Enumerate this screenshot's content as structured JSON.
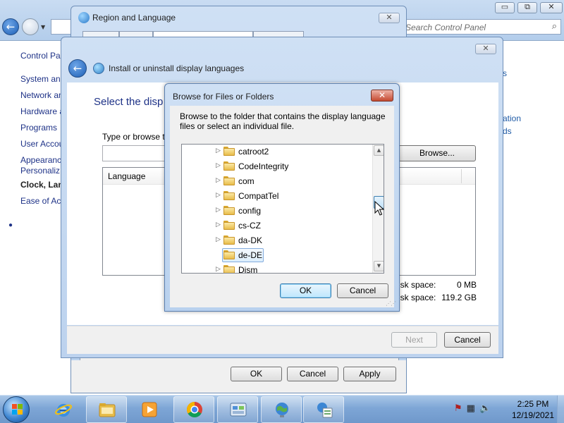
{
  "control_panel": {
    "search_placeholder": "Search Control Panel",
    "window_buttons": [
      "▭",
      "⧉",
      "✕"
    ],
    "sidebar": [
      {
        "label": "Control Pa",
        "active": false
      },
      {
        "label": "System and",
        "active": false
      },
      {
        "label": "Network an",
        "active": false
      },
      {
        "label": "Hardware a",
        "active": false
      },
      {
        "label": "Programs",
        "active": false
      },
      {
        "label": "User Accou",
        "active": false
      },
      {
        "label": "Appearanc",
        "active": false
      },
      {
        "label": "Personaliz",
        "active": false
      },
      {
        "label": "Clock, Lang",
        "active": true
      },
      {
        "label": "Ease of Acc",
        "active": false
      }
    ],
    "right_links": [
      "s",
      "ation",
      "ds"
    ]
  },
  "region_language": {
    "title": "Region and Language",
    "close_glyph": "✕",
    "ok_label": "OK",
    "cancel_label": "Cancel",
    "apply_label": "Apply"
  },
  "install_dialog": {
    "title": "Install or uninstall display languages",
    "heading": "Select the disp",
    "type_label": "Type or browse t",
    "browse_label": "Browse...",
    "column_language": "Language",
    "disk_required_label": "isk space:",
    "disk_required_value": "0 MB",
    "disk_available_label": "isk space:",
    "disk_available_value": "119.2 GB",
    "next_label": "Next",
    "cancel_label": "Cancel",
    "close_glyph": "✕",
    "back_glyph": "←"
  },
  "browse_dialog": {
    "title": "Browse for Files or Folders",
    "close_glyph": "✕",
    "instructions": "Browse to the folder that contains the display language files or select an individual file.",
    "tree": [
      {
        "label": "catroot2",
        "selected": false
      },
      {
        "label": "CodeIntegrity",
        "selected": false
      },
      {
        "label": "com",
        "selected": false
      },
      {
        "label": "CompatTel",
        "selected": false
      },
      {
        "label": "config",
        "selected": false
      },
      {
        "label": "cs-CZ",
        "selected": false
      },
      {
        "label": "da-DK",
        "selected": false
      },
      {
        "label": "de-DE",
        "selected": true
      },
      {
        "label": "Dism",
        "selected": false
      }
    ],
    "ok_label": "OK",
    "cancel_label": "Cancel"
  },
  "taskbar": {
    "time": "2:25 PM",
    "date": "12/19/2021",
    "apps": [
      "internet-explorer",
      "windows-explorer",
      "media-player",
      "chrome",
      "control-panel",
      "region-globe",
      "language-tool"
    ]
  },
  "colors": {
    "link_blue": "#1e3287",
    "title_bar": "#b9d1ee",
    "close_red": "#c54a31",
    "selection": "#dceefc"
  }
}
